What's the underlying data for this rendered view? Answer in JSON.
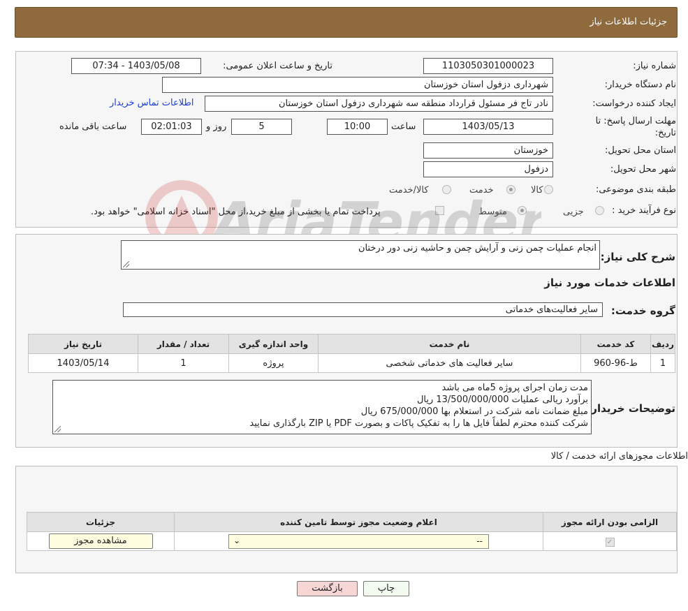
{
  "header": {
    "title": "جزئیات اطلاعات نیاز"
  },
  "form": {
    "need_number_label": "شماره نیاز:",
    "need_number": "1103050301000023",
    "announce_label": "تاریخ و ساعت اعلان عمومی:",
    "announce_value": "1403/05/08 - 07:34",
    "buyer_org_label": "نام دستگاه خریدار:",
    "buyer_org": "شهرداری دزفول استان خوزستان",
    "creator_label": "ایجاد کننده درخواست:",
    "creator": "نادر تاج فر مسئول قرارداد منطقه سه شهرداری دزفول استان خوزستان",
    "contact_link": "اطلاعات تماس خریدار",
    "deadline_label": "مهلت ارسال پاسخ: تا تاریخ:",
    "deadline_date": "1403/05/13",
    "time_label": "ساعت",
    "deadline_time": "10:00",
    "days_value": "5",
    "days_label": "روز و",
    "remaining_value": "02:01:03",
    "remaining_label": "ساعت باقی مانده",
    "province_label": "استان محل تحویل:",
    "province": "خوزستان",
    "city_label": "شهر محل تحویل:",
    "city": "دزفول",
    "category_label": "طبقه بندی موضوعی:",
    "category_options": [
      "کالا",
      "خدمت",
      "کالا/خدمت"
    ],
    "process_label": "نوع فرآیند خرید :",
    "process_options": [
      "جزیی",
      "متوسط"
    ],
    "payment_note": "پرداخت تمام یا بخشی از مبلغ خرید،از محل \"اسناد خزانه اسلامی\" خواهد بود."
  },
  "summary": {
    "label": "شرح کلی نیاز:",
    "text": "انجام عملیات چمن زنی و آرایش چمن و حاشیه زنی دور درختان",
    "services_title": "اطلاعات خدمات مورد نیاز",
    "group_label": "گروه خدمت:",
    "group_value": "سایر فعالیت‌های خدماتی"
  },
  "services_table": {
    "headers": [
      "ردیف",
      "کد خدمت",
      "نام خدمت",
      "واحد اندازه گیری",
      "تعداد / مقدار",
      "تاریخ نیاز"
    ],
    "rows": [
      [
        "1",
        "ط-96-960",
        "سایر فعالیت های خدماتی شخصی",
        "پروژه",
        "1",
        "1403/05/14"
      ]
    ]
  },
  "buyer_notes": {
    "label": "توضیحات خریدار:",
    "lines": [
      "مدت زمان اجرای پروژه 5ماه می باشد",
      "برآورد ریالی عملیات 13/500/000/000 ریال",
      "مبلغ ضمانت نامه شرکت در استعلام بها 675/000/000 ریال",
      "شرکت کننده محترم لطفاً فایل ها را به تفکیک پاکات و بصورت PDF یا ZIP بارگذاری نمایید"
    ]
  },
  "permits": {
    "title": "اطلاعات مجوزهای ارائه خدمت / کالا",
    "headers": [
      "الزامی بودن ارائه مجوز",
      "اعلام وضعیت مجوز توسط تامین کننده",
      "جزئیات"
    ],
    "select_value": "--",
    "view_button": "مشاهده مجوز"
  },
  "buttons": {
    "print": "چاپ",
    "back": "بازگشت"
  },
  "watermark": {
    "text": "AriaTender.neT"
  },
  "colors": {
    "header_bg": "#8f6a3d",
    "link": "#1a3fd4",
    "back_btn_bg": "#f7d6d6",
    "view_btn_bg": "#fffde0"
  }
}
